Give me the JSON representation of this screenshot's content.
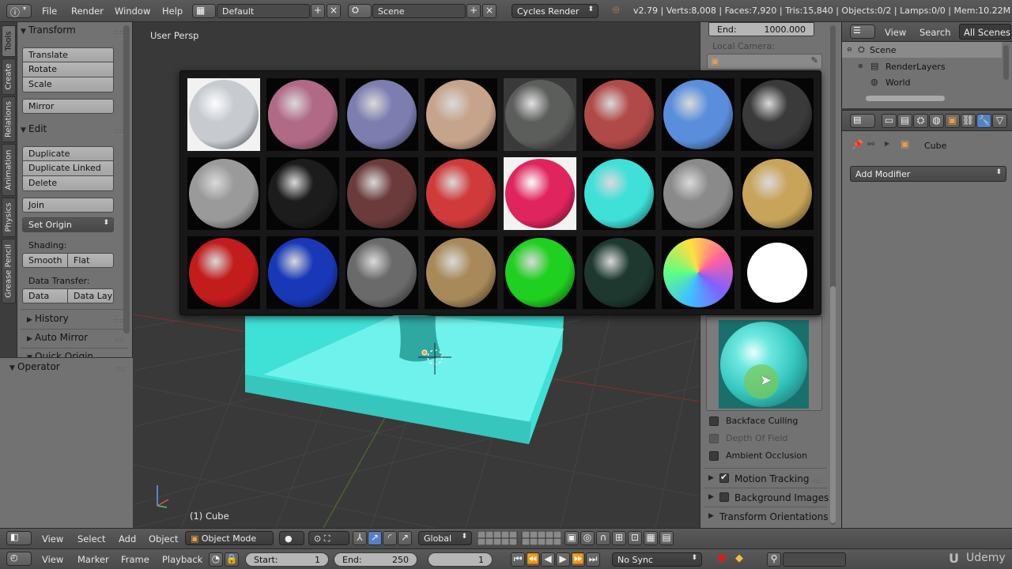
{
  "topbar": {
    "menus": [
      "File",
      "Render",
      "Window",
      "Help"
    ],
    "screen_layout": "Default",
    "scene": "Scene",
    "render_engine": "Cycles Render",
    "stats": "v2.79 | Verts:8,008 | Faces:7,920 | Tris:15,840 | Objects:0/2 | Lamps:0/0 | Mem:10.22M | Cube"
  },
  "tool_tabs": [
    "Tools",
    "Create",
    "Relations",
    "Animation",
    "Physics",
    "Grease Pencil"
  ],
  "toolshelf": {
    "transform_header": "Transform",
    "translate": "Translate",
    "rotate": "Rotate",
    "scale": "Scale",
    "mirror": "Mirror",
    "edit_header": "Edit",
    "duplicate": "Duplicate",
    "duplicate_linked": "Duplicate Linked",
    "delete": "Delete",
    "join": "Join",
    "set_origin": "Set Origin",
    "shading_label": "Shading:",
    "smooth": "Smooth",
    "flat": "Flat",
    "data_transfer_label": "Data Transfer:",
    "data": "Data",
    "data_lay": "Data Lay",
    "history_header": "History",
    "auto_mirror_header": "Auto Mirror",
    "quick_origin_header": "Quick Origin",
    "operator_header": "Operator"
  },
  "viewport": {
    "view_label": "User Persp",
    "object_label": "(1) Cube"
  },
  "matcaps": [
    "#c7cbd0",
    "#b06a86",
    "#7d7db0",
    "#c6a48c",
    "#5c5e5c",
    "#b04a48",
    "#5a8edc",
    "#3a3a3a",
    "#9a9a9a",
    "#1c1c1c",
    "#6b3b3b",
    "#d03a3a",
    "#e0245e",
    "#3ee0d8",
    "#8a8a8a",
    "#c8a45a",
    "#c21c1c",
    "#1838b8",
    "#6a6a6a",
    "#a88a5a",
    "#20d020",
    "#1e3830",
    "#a050e0",
    "#ffffff"
  ],
  "npanel": {
    "end_label": "End:",
    "end_value": "1000.000",
    "local_camera_label": "Local Camera:",
    "backface_culling": "Backface Culling",
    "depth_of_field": "Depth Of Field",
    "ambient_occlusion": "Ambient Occlusion",
    "motion_tracking": "Motion Tracking",
    "background_images": "Background Images",
    "transform_orientations": "Transform Orientations"
  },
  "outliner": {
    "view": "View",
    "search": "Search",
    "filter": "All Scenes",
    "items": [
      "Scene",
      "RenderLayers",
      "World"
    ]
  },
  "properties": {
    "object_name": "Cube",
    "add_modifier": "Add Modifier"
  },
  "view3d_header": {
    "menus": [
      "View",
      "Select",
      "Add",
      "Object"
    ],
    "mode": "Object Mode",
    "orientation": "Global"
  },
  "timeline": {
    "menus": [
      "View",
      "Marker",
      "Frame",
      "Playback"
    ],
    "start_label": "Start:",
    "start_value": "1",
    "end_label": "End:",
    "end_value": "250",
    "current_frame": "1",
    "sync": "No Sync"
  },
  "watermark": "Udemy"
}
